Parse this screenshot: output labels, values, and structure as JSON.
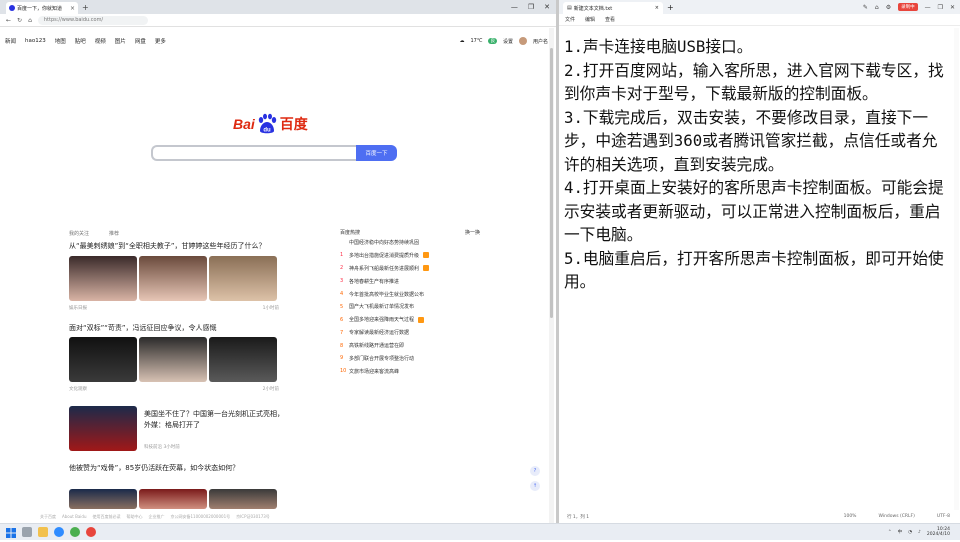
{
  "browser": {
    "tab_title": "百度一下，你就知道",
    "tab_close": "×",
    "tab_add": "+",
    "window_controls": [
      "—",
      "❐",
      "✕"
    ],
    "url": "https://www.baidu.com/",
    "nav_links": [
      "新闻",
      "hao123",
      "地图",
      "贴吧",
      "视频",
      "图片",
      "网盘",
      "更多"
    ],
    "nav_right": {
      "weather_temp": "17℃",
      "weather_badge": "良",
      "settings": "设置",
      "user": "用户名"
    },
    "search_button": "百度一下",
    "feed_tabs": [
      "我的关注",
      "推荐"
    ],
    "news": [
      {
        "title": "从“最美刺绣娘”到“全职相夫教子”，甘婷婷这些年经历了什么？",
        "source": "娱乐日报",
        "time": "1小时前"
      },
      {
        "title": "面对“双标”“苛责”，冯远征回应争议，令人感慨",
        "source": "文化观察",
        "time": "2小时前"
      },
      {
        "title": "美国坐不住了？中国第一台光刻机正式亮相，外媒：格局打开了",
        "source": "科技前沿",
        "time": "3小时前"
      },
      {
        "title": "他被赞为“戏骨”，85岁仍活跃在荧幕，如今状态如何？",
        "source": "",
        "time": ""
      }
    ],
    "hot_header": "百度热搜",
    "hot_refresh": "换一换",
    "hot_list": [
      {
        "rank": "",
        "text": "中国经济稳中向好态势持续巩固",
        "tag": false
      },
      {
        "rank": "1",
        "text": "多地出台措施促进消费提质升级",
        "tag": true
      },
      {
        "rank": "2",
        "text": "神舟系列飞船最新任务进展顺利",
        "tag": true
      },
      {
        "rank": "3",
        "text": "各地春耕生产有序推进",
        "tag": false
      },
      {
        "rank": "4",
        "text": "今年首批高校毕业生就业数据公布",
        "tag": false
      },
      {
        "rank": "5",
        "text": "国产大飞机最新订单情况发布",
        "tag": false
      },
      {
        "rank": "6",
        "text": "全国多地迎来强降雨天气过程",
        "tag": true
      },
      {
        "rank": "7",
        "text": "专家解读最新经济运行数据",
        "tag": false
      },
      {
        "rank": "8",
        "text": "高铁新线路开通运营在即",
        "tag": false
      },
      {
        "rank": "9",
        "text": "多部门联合开展专项整治行动",
        "tag": false
      },
      {
        "rank": "10",
        "text": "文旅市场迎来客流高峰",
        "tag": false
      }
    ],
    "footer_links": [
      "关于百度",
      "About Baidu",
      "使用百度前必读",
      "帮助中心",
      "企业推广",
      "京公网安备11000002000001号",
      "京ICP证030173号"
    ],
    "float_buttons": [
      "?",
      "↑"
    ]
  },
  "notepad": {
    "tab_title": "新建文本文档.txt",
    "tab_close": "×",
    "tab_add": "+",
    "toolbar_icons": [
      "✎",
      "⌂",
      "⚙"
    ],
    "record_label": "录制中",
    "window_controls": [
      "—",
      "❐",
      "✕"
    ],
    "menu": [
      "文件",
      "编辑",
      "查看"
    ],
    "content": "1.声卡连接电脑USB接口。\n2.打开百度网站，输入客所思，进入官网下载专区，找到你声卡对于型号，下载最新版的控制面板。\n3.下载完成后，双击安装，不要修改目录，直接下一步，中途若遇到360或者腾讯管家拦截，点信任或者允许的相关选项，直到安装完成。\n4.打开桌面上安装好的客所思声卡控制面板。可能会提示安装或者更新驱动，可以正常进入控制面板后，重启一下电脑。\n5.电脑重启后，打开客所思声卡控制面板，即可开始使用。",
    "status_position": "行 1，列 1",
    "status_zoom": "100%",
    "status_eol": "Windows (CRLF)",
    "status_encoding": "UTF-8"
  },
  "taskbar": {
    "tray_lang": "中",
    "time": "10:24",
    "date": "2024/4/10"
  }
}
